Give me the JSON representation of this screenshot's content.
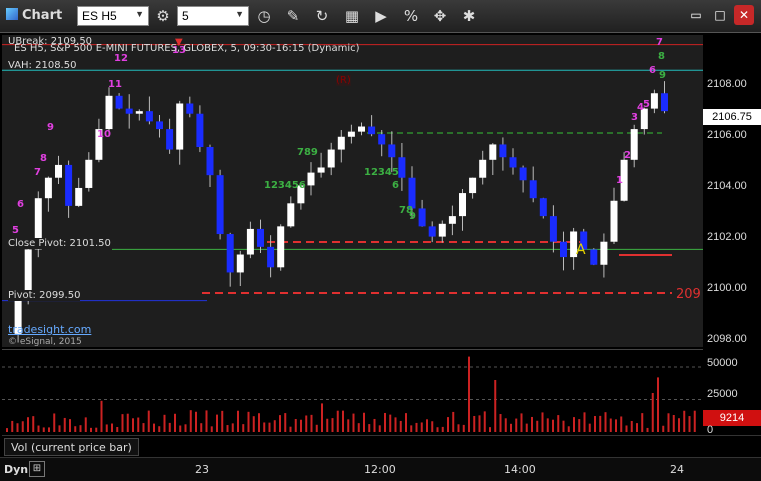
{
  "toolbar": {
    "title": "Chart",
    "symbol": "ES H5",
    "interval": "5",
    "buttons": [
      "gear-icon",
      "clock-icon",
      "pencil-icon",
      "curve-icon",
      "quote-icon",
      "play-icon",
      "percent-icon",
      "move-icon",
      "star-icon"
    ]
  },
  "chart": {
    "header": "ES H5, S&P 500 E-MINI FUTURES, GLOBEX, 5, 09:30-16:15 (Dynamic)",
    "ubreak_label": "UBreak: 2109.50",
    "vah_label": "VAH: 2108.50",
    "close_pivot_label": "Close Pivot: 2101.50",
    "pivot_label": "Pivot: 2099.50",
    "watermark": "tradesight.com",
    "copyright": "© eSignal, 2015",
    "right_edge_label": "209",
    "a_label": "A",
    "r_label": "(R)",
    "price_axis": [
      "2108.00",
      "2106.00",
      "2104.00",
      "2102.00",
      "2100.00",
      "2098.00"
    ],
    "last_price": "2106.75"
  },
  "volume": {
    "axis": [
      "50000",
      "25000",
      "0"
    ],
    "last_volume": "9214",
    "label": "Vol (current price bar)"
  },
  "timeline": {
    "dyn_label": "Dyn",
    "ticks": [
      "23",
      "12:00",
      "14:00",
      "24"
    ]
  },
  "chart_data": {
    "type": "candlestick",
    "symbol": "ES H5",
    "interval_minutes": 5,
    "price_range": [
      2097.5,
      2110.5
    ],
    "levels": [
      {
        "name": "UBreak",
        "value": 2109.5
      },
      {
        "name": "VAH",
        "value": 2108.5
      },
      {
        "name": "Close Pivot",
        "value": 2101.5
      },
      {
        "name": "Pivot",
        "value": 2099.5
      }
    ],
    "last_price": 2106.75,
    "last_volume": 9214,
    "volume_range": [
      0,
      60000
    ]
  },
  "colors": {
    "up": "#ffffff",
    "down": "#1a2cff",
    "ubreak": "#cc2222",
    "vah": "#22bbbb",
    "pivot": "#3cb043",
    "dashed_red": "#e03030",
    "dashed_green": "#2e8b2e",
    "volume": "#cc2222"
  }
}
